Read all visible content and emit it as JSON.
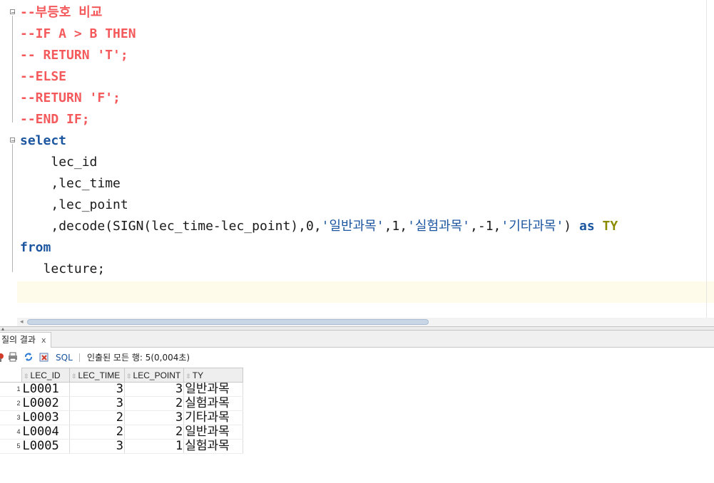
{
  "editor": {
    "lines": [
      {
        "indent": "",
        "tokens": [
          {
            "t": "--부등호 비교",
            "c": "cmt"
          }
        ]
      },
      {
        "indent": "",
        "tokens": [
          {
            "t": "--IF A > B THEN",
            "c": "cmt"
          }
        ]
      },
      {
        "indent": "",
        "tokens": [
          {
            "t": "-- RETURN 'T';",
            "c": "cmt"
          }
        ]
      },
      {
        "indent": "",
        "tokens": [
          {
            "t": "--ELSE",
            "c": "cmt"
          }
        ]
      },
      {
        "indent": "",
        "tokens": [
          {
            "t": "--RETURN 'F';",
            "c": "cmt"
          }
        ]
      },
      {
        "indent": "",
        "tokens": [
          {
            "t": "--END IF;",
            "c": "cmt"
          }
        ]
      },
      {
        "indent": "",
        "tokens": [
          {
            "t": "select",
            "c": "kw"
          }
        ]
      },
      {
        "indent": "    ",
        "tokens": [
          {
            "t": "lec_id",
            "c": "tx"
          }
        ]
      },
      {
        "indent": "    ",
        "tokens": [
          {
            "t": ",lec_time",
            "c": "tx"
          }
        ]
      },
      {
        "indent": "    ",
        "tokens": [
          {
            "t": ",lec_point",
            "c": "tx"
          }
        ]
      },
      {
        "indent": "    ",
        "tokens": [
          {
            "t": ",decode(SIGN(lec_time-lec_point),0,",
            "c": "tx"
          },
          {
            "t": "'일반과목'",
            "c": "str"
          },
          {
            "t": ",1,",
            "c": "tx"
          },
          {
            "t": "'실험과목'",
            "c": "str"
          },
          {
            "t": ",-1,",
            "c": "tx"
          },
          {
            "t": "'기타과목'",
            "c": "str"
          },
          {
            "t": ") ",
            "c": "tx"
          },
          {
            "t": "as",
            "c": "kw"
          },
          {
            "t": " ",
            "c": "tx"
          },
          {
            "t": "TY",
            "c": "kw2"
          }
        ]
      },
      {
        "indent": "",
        "tokens": [
          {
            "t": "from",
            "c": "kw"
          }
        ]
      },
      {
        "indent": "   ",
        "tokens": [
          {
            "t": "lecture;",
            "c": "tx"
          }
        ]
      },
      {
        "indent": "",
        "tokens": []
      }
    ]
  },
  "results": {
    "tab_label": "질의 결과",
    "tab_close": "x",
    "toolbar": {
      "sql_label": "SQL",
      "status_text": "인출된 모든 행: 5(0,004초)",
      "icons": [
        "pin-icon",
        "print-icon",
        "refresh-icon",
        "delete-icon"
      ]
    },
    "columns": [
      "LEC_ID",
      "LEC_TIME",
      "LEC_POINT",
      "TY"
    ],
    "rows": [
      {
        "n": "1",
        "cells": [
          "L0001",
          "3",
          "3",
          "일반과목"
        ]
      },
      {
        "n": "2",
        "cells": [
          "L0002",
          "3",
          "2",
          "실험과목"
        ]
      },
      {
        "n": "3",
        "cells": [
          "L0003",
          "2",
          "3",
          "기타과목"
        ]
      },
      {
        "n": "4",
        "cells": [
          "L0004",
          "2",
          "2",
          "일반과목"
        ]
      },
      {
        "n": "5",
        "cells": [
          "L0005",
          "3",
          "1",
          "실험과목"
        ]
      }
    ]
  },
  "colors": {
    "comment": "#f4595b",
    "keyword": "#1c56a0",
    "alias": "#8b8b00",
    "current_line": "#fffbea"
  }
}
